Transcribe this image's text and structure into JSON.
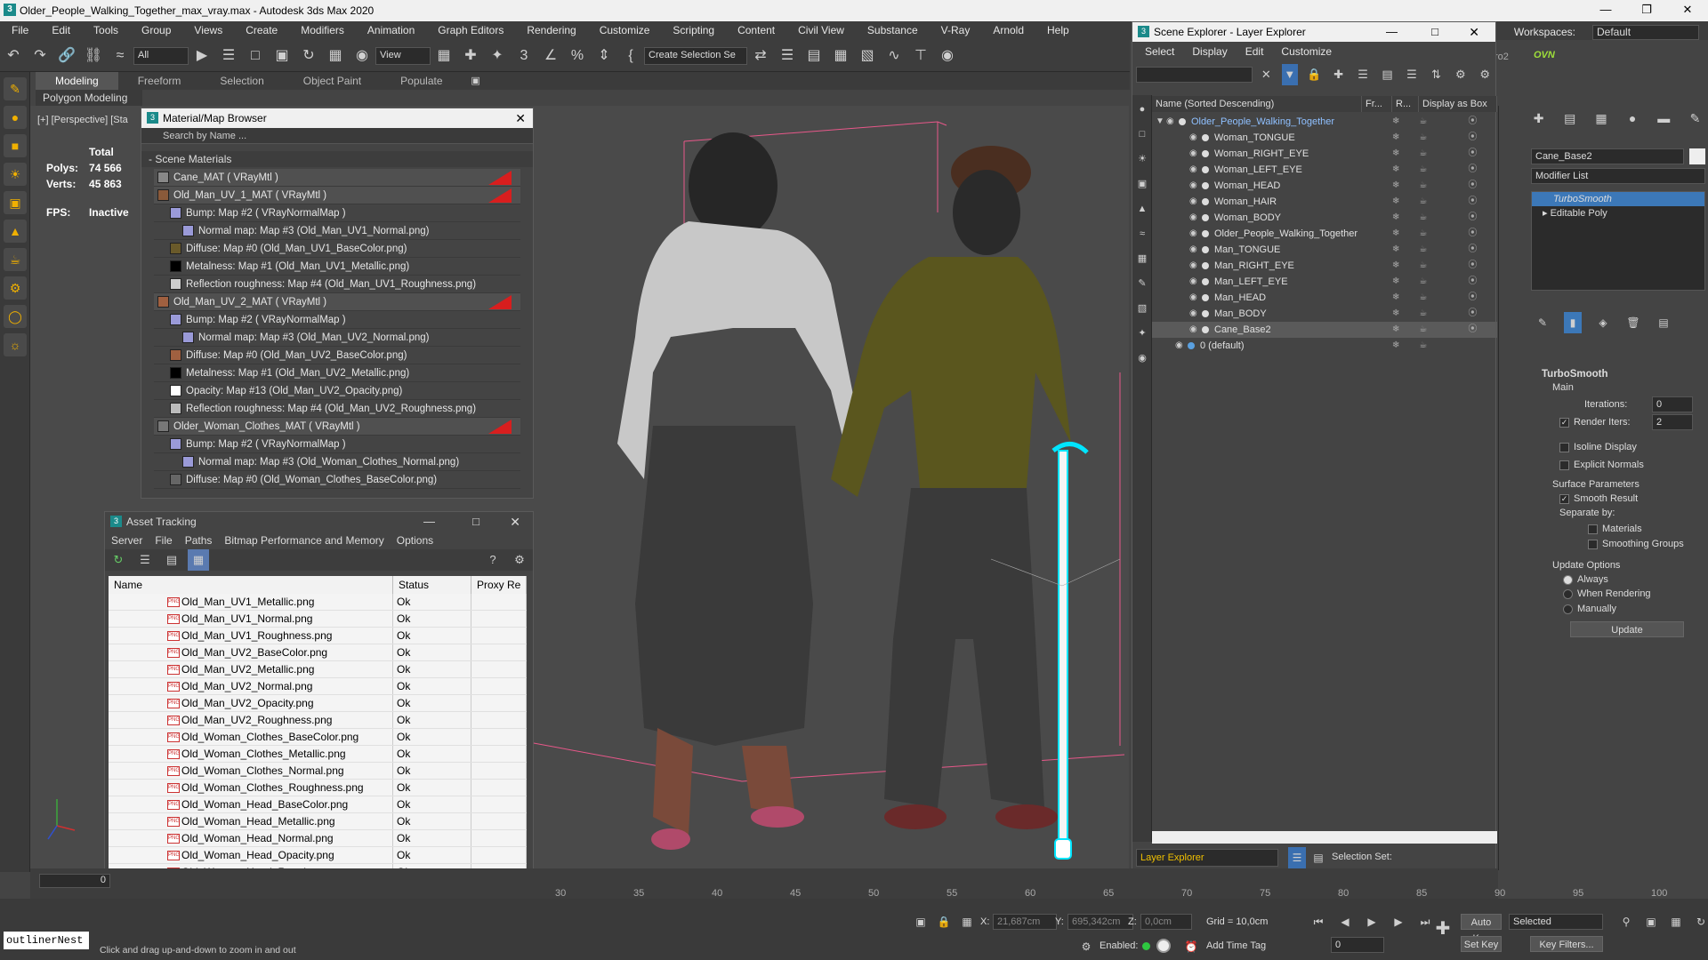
{
  "window": {
    "title": "Older_People_Walking_Together_max_vray.max - Autodesk 3ds Max 2020",
    "app_icon": "3"
  },
  "menu": [
    "File",
    "Edit",
    "Tools",
    "Group",
    "Views",
    "Create",
    "Modifiers",
    "Animation",
    "Graph Editors",
    "Rendering",
    "Customize",
    "Scripting",
    "Content",
    "Civil View",
    "Substance",
    "V-Ray",
    "Arnold",
    "Help"
  ],
  "workspaces": {
    "label": "Workspaces:",
    "value": "Default"
  },
  "toolbar": {
    "filter": "All",
    "view": "View",
    "create_selection": "Create Selection Se",
    "ovn": "OVN",
    "ro2": "ro2"
  },
  "ribbon": {
    "tabs": [
      "Modeling",
      "Freeform",
      "Selection",
      "Object Paint",
      "Populate"
    ],
    "sub": "Polygon Modeling"
  },
  "viewport": {
    "label": "[+] [Perspective] [Sta",
    "stats": {
      "total": "Total",
      "polys_label": "Polys:",
      "polys": "74 566",
      "verts_label": "Verts:",
      "verts": "45 863",
      "fps_label": "FPS:",
      "fps": "Inactive"
    }
  },
  "material_browser": {
    "title": "Material/Map Browser",
    "search": "Search by Name ...",
    "section": "- Scene Materials",
    "rows": [
      {
        "text": "Cane_MAT  ( VRayMtl )",
        "indent": 0,
        "top": true,
        "red": true,
        "sw": "#888888"
      },
      {
        "text": "Old_Man_UV_1_MAT  ( VRayMtl )",
        "indent": 0,
        "top": true,
        "red": true,
        "sw": "#8a5a3a"
      },
      {
        "text": "Bump: Map #2  ( VRayNormalMap )",
        "indent": 1,
        "sw": "#9a9ad8"
      },
      {
        "text": "Normal map: Map #3 (Old_Man_UV1_Normal.png)",
        "indent": 2,
        "sw": "#9a9ad8"
      },
      {
        "text": "Diffuse: Map #0 (Old_Man_UV1_BaseColor.png)",
        "indent": 1,
        "sw": "#6a5a2a"
      },
      {
        "text": "Metalness: Map #1 (Old_Man_UV1_Metallic.png)",
        "indent": 1,
        "sw": "#000000"
      },
      {
        "text": "Reflection roughness: Map #4 (Old_Man_UV1_Roughness.png)",
        "indent": 1,
        "sw": "#cccccc"
      },
      {
        "text": "Old_Man_UV_2_MAT  ( VRayMtl )",
        "indent": 0,
        "top": true,
        "red": true,
        "sw": "#a06040"
      },
      {
        "text": "Bump: Map #2  ( VRayNormalMap )",
        "indent": 1,
        "sw": "#9a9ad8"
      },
      {
        "text": "Normal map: Map #3 (Old_Man_UV2_Normal.png)",
        "indent": 2,
        "sw": "#9a9ad8"
      },
      {
        "text": "Diffuse: Map #0 (Old_Man_UV2_BaseColor.png)",
        "indent": 1,
        "sw": "#a06040"
      },
      {
        "text": "Metalness: Map #1 (Old_Man_UV2_Metallic.png)",
        "indent": 1,
        "sw": "#000000"
      },
      {
        "text": "Opacity: Map #13 (Old_Man_UV2_Opacity.png)",
        "indent": 1,
        "sw": "#ffffff"
      },
      {
        "text": "Reflection roughness: Map #4 (Old_Man_UV2_Roughness.png)",
        "indent": 1,
        "sw": "#bbbbbb"
      },
      {
        "text": "Older_Woman_Clothes_MAT  ( VRayMtl )",
        "indent": 0,
        "top": true,
        "red": true,
        "sw": "#777777"
      },
      {
        "text": "Bump: Map #2  ( VRayNormalMap )",
        "indent": 1,
        "sw": "#9a9ad8"
      },
      {
        "text": "Normal map: Map #3 (Old_Woman_Clothes_Normal.png)",
        "indent": 2,
        "sw": "#9a9ad8"
      },
      {
        "text": "Diffuse: Map #0 (Old_Woman_Clothes_BaseColor.png)",
        "indent": 1,
        "sw": "#666666"
      }
    ]
  },
  "asset_tracking": {
    "title": "Asset Tracking",
    "menu": [
      "Server",
      "File",
      "Paths",
      "Bitmap Performance and Memory",
      "Options"
    ],
    "columns": [
      "Name",
      "Status",
      "Proxy Re"
    ],
    "rows": [
      {
        "name": "Old_Man_UV1_Metallic.png",
        "status": "Ok"
      },
      {
        "name": "Old_Man_UV1_Normal.png",
        "status": "Ok"
      },
      {
        "name": "Old_Man_UV1_Roughness.png",
        "status": "Ok"
      },
      {
        "name": "Old_Man_UV2_BaseColor.png",
        "status": "Ok"
      },
      {
        "name": "Old_Man_UV2_Metallic.png",
        "status": "Ok"
      },
      {
        "name": "Old_Man_UV2_Normal.png",
        "status": "Ok"
      },
      {
        "name": "Old_Man_UV2_Opacity.png",
        "status": "Ok"
      },
      {
        "name": "Old_Man_UV2_Roughness.png",
        "status": "Ok"
      },
      {
        "name": "Old_Woman_Clothes_BaseColor.png",
        "status": "Ok"
      },
      {
        "name": "Old_Woman_Clothes_Metallic.png",
        "status": "Ok"
      },
      {
        "name": "Old_Woman_Clothes_Normal.png",
        "status": "Ok"
      },
      {
        "name": "Old_Woman_Clothes_Roughness.png",
        "status": "Ok"
      },
      {
        "name": "Old_Woman_Head_BaseColor.png",
        "status": "Ok"
      },
      {
        "name": "Old_Woman_Head_Metallic.png",
        "status": "Ok"
      },
      {
        "name": "Old_Woman_Head_Normal.png",
        "status": "Ok"
      },
      {
        "name": "Old_Woman_Head_Opacity.png",
        "status": "Ok"
      },
      {
        "name": "Old_Woman_Head_Roughness.png",
        "status": "Ok"
      }
    ],
    "badge": "PNG"
  },
  "scene_explorer": {
    "title": "Scene Explorer - Layer Explorer",
    "menu": [
      "Select",
      "Display",
      "Edit",
      "Customize"
    ],
    "columns": [
      "Name (Sorted Descending)",
      "Fr...",
      "R...",
      "Display as Box"
    ],
    "rows": [
      {
        "name": "Older_People_Walking_Together",
        "level": 1,
        "group": true
      },
      {
        "name": "Woman_TONGUE",
        "level": 2
      },
      {
        "name": "Woman_RIGHT_EYE",
        "level": 2
      },
      {
        "name": "Woman_LEFT_EYE",
        "level": 2
      },
      {
        "name": "Woman_HEAD",
        "level": 2
      },
      {
        "name": "Woman_HAIR",
        "level": 2
      },
      {
        "name": "Woman_BODY",
        "level": 2
      },
      {
        "name": "Older_People_Walking_Together",
        "level": 2
      },
      {
        "name": "Man_TONGUE",
        "level": 2
      },
      {
        "name": "Man_RIGHT_EYE",
        "level": 2
      },
      {
        "name": "Man_LEFT_EYE",
        "level": 2
      },
      {
        "name": "Man_HEAD",
        "level": 2
      },
      {
        "name": "Man_BODY",
        "level": 2
      },
      {
        "name": "Cane_Base2",
        "level": 2,
        "selected": true
      },
      {
        "name": "0 (default)",
        "level": 0
      }
    ],
    "footer": {
      "explorer": "Layer Explorer",
      "selection_set": "Selection Set:"
    }
  },
  "command_panel": {
    "object_name": "Cane_Base2",
    "modifier_list": "Modifier List",
    "stack": [
      "TurboSmooth",
      "Editable Poly"
    ],
    "turbosmooth": {
      "title": "TurboSmooth",
      "main": "Main",
      "iterations_label": "Iterations:",
      "iterations": "0",
      "render_iters_label": "Render Iters:",
      "render_iters": "2",
      "isoline": "Isoline Display",
      "explicit": "Explicit Normals",
      "surface": "Surface Parameters",
      "smooth_result": "Smooth Result",
      "separate": "Separate by:",
      "materials": "Materials",
      "smoothing_groups": "Smoothing Groups",
      "update_options": "Update Options",
      "always": "Always",
      "when_rendering": "When Rendering",
      "manually": "Manually",
      "update": "Update"
    }
  },
  "timeline": {
    "frame": "0",
    "ticks": [
      "30",
      "35",
      "40",
      "45",
      "50",
      "55",
      "60",
      "65",
      "70",
      "75",
      "80",
      "85",
      "90",
      "95",
      "100"
    ]
  },
  "status": {
    "prompt": "Click and drag up-and-down to zoom in and out",
    "listener": "outlinerNest",
    "x_label": "X:",
    "x": "21,687cm",
    "y_label": "Y:",
    "y": "695,342cm",
    "z_label": "Z:",
    "z": "0,0cm",
    "grid": "Grid = 10,0cm",
    "enabled": "Enabled:",
    "add_time_tag": "Add Time Tag",
    "auto_key": "Auto Key",
    "selected": "Selected",
    "set_key": "Set Key",
    "key_filters": "Key Filters...",
    "frame_field": "0"
  },
  "colors": {
    "accent": "#4aa3df",
    "selection": "#00e5ff"
  }
}
